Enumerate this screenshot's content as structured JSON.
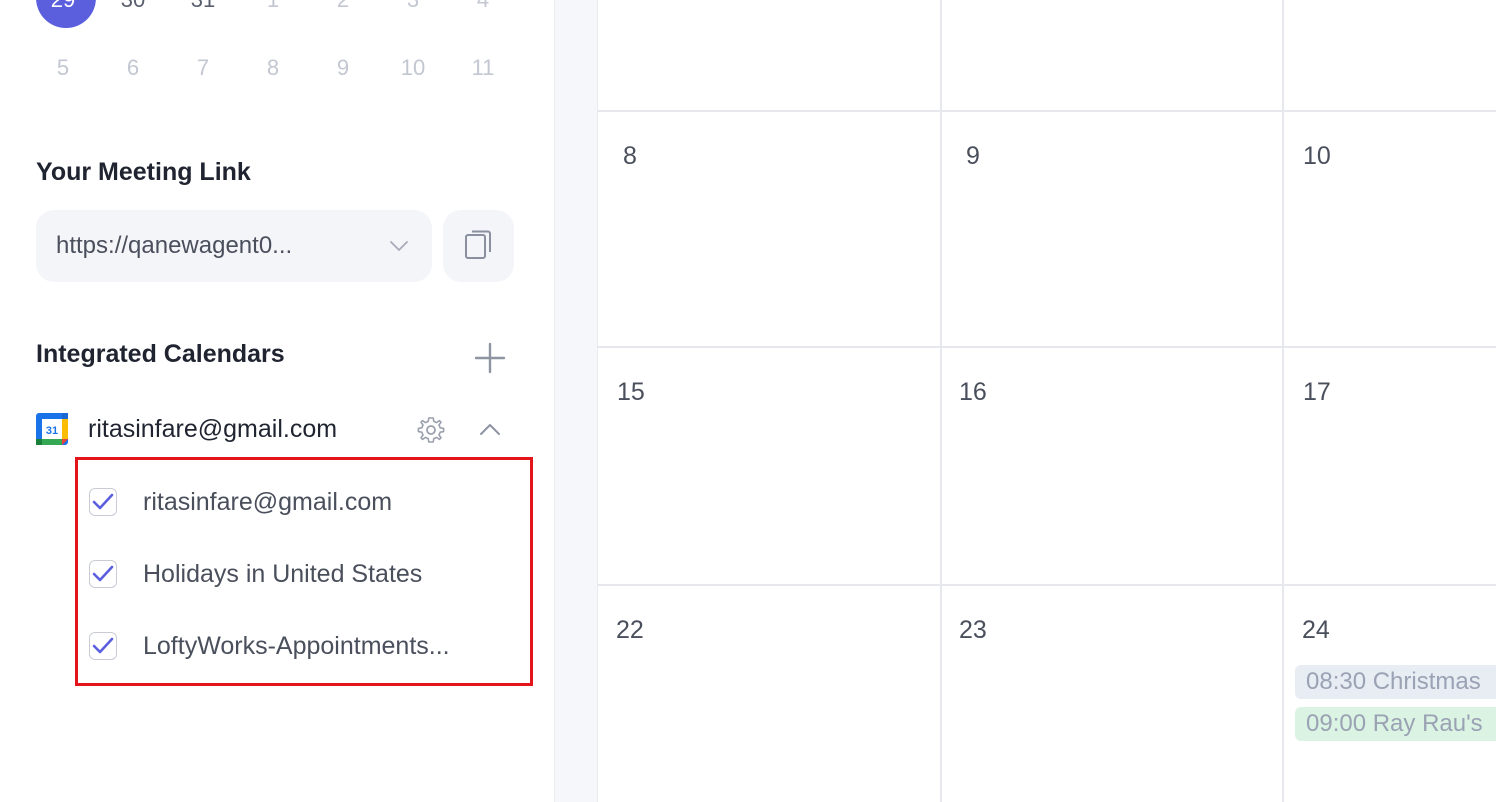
{
  "mini_calendar": {
    "row1": [
      {
        "label": "29",
        "state": "selected"
      },
      {
        "label": "30",
        "state": "current"
      },
      {
        "label": "31",
        "state": "current"
      },
      {
        "label": "1",
        "state": "muted"
      },
      {
        "label": "2",
        "state": "muted"
      },
      {
        "label": "3",
        "state": "muted"
      },
      {
        "label": "4",
        "state": "muted"
      }
    ],
    "row2": [
      "5",
      "6",
      "7",
      "8",
      "9",
      "10",
      "11"
    ]
  },
  "meeting_link": {
    "title": "Your Meeting Link",
    "value": "https://qanewagent0..."
  },
  "integrated": {
    "title": "Integrated Calendars",
    "account_email": "ritasinfare@gmail.com",
    "calendars": [
      {
        "label": "ritasinfare@gmail.com",
        "checked": true
      },
      {
        "label": "Holidays in United States",
        "checked": true
      },
      {
        "label": "LoftyWorks-Appointments...",
        "checked": true
      }
    ]
  },
  "calendar_grid": {
    "weeks": [
      [
        "8",
        "9",
        "10"
      ],
      [
        "15",
        "16",
        "17"
      ],
      [
        "22",
        "23",
        "24"
      ]
    ],
    "events": [
      {
        "text": "08:30 Christmas",
        "color": "#e8ecf3",
        "text_color": "#9aa2b4"
      },
      {
        "text": "09:00 Ray Rau's",
        "color": "#daf3e3",
        "text_color": "#9aa2b4"
      }
    ]
  },
  "colors": {
    "accent": "#5b5fde",
    "highlight_border": "#e3141a"
  },
  "icons": {
    "dropdown": "chevron-down-icon",
    "copy": "copy-icon",
    "add": "plus-icon",
    "account": "google-calendar-icon",
    "settings": "gear-icon",
    "collapse": "chevron-up-icon",
    "check": "checkbox-checked-icon"
  }
}
